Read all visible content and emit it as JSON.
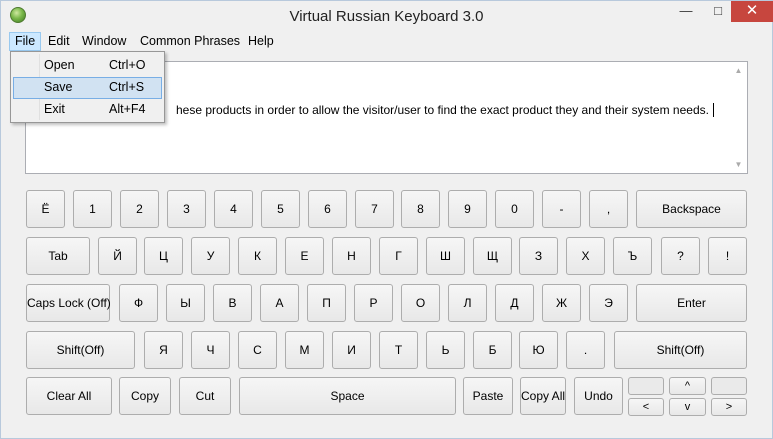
{
  "window": {
    "title": "Virtual Russian Keyboard 3.0",
    "minimize_glyph": "—",
    "maximize_glyph": "□",
    "close_glyph": "✕"
  },
  "menu": {
    "items": [
      "File",
      "Edit",
      "Window",
      "Common Phrases",
      "Help"
    ],
    "active": "File",
    "file_dropdown": [
      {
        "label": "Open",
        "shortcut": "Ctrl+O"
      },
      {
        "label": "Save",
        "shortcut": "Ctrl+S"
      },
      {
        "label": "Exit",
        "shortcut": "Alt+F4"
      }
    ],
    "hovered": "Save"
  },
  "editor": {
    "visible_text": "hese products in order to allow the visitor/user to find the exact product they and their system needs."
  },
  "scrollbar": {
    "up_glyph": "▲",
    "down_glyph": "▼"
  },
  "keyboard": {
    "row1": [
      "Ё",
      "1",
      "2",
      "3",
      "4",
      "5",
      "6",
      "7",
      "8",
      "9",
      "0",
      "-",
      ",",
      "Backspace"
    ],
    "row2": [
      "Tab",
      "Й",
      "Ц",
      "У",
      "К",
      "Е",
      "Н",
      "Г",
      "Ш",
      "Щ",
      "З",
      "Х",
      "Ъ",
      "?",
      "!"
    ],
    "row3": [
      "Caps Lock (Off)",
      "Ф",
      "Ы",
      "В",
      "А",
      "П",
      "Р",
      "О",
      "Л",
      "Д",
      "Ж",
      "Э",
      "Enter"
    ],
    "row4": [
      "Shift(Off)",
      "Я",
      "Ч",
      "С",
      "М",
      "И",
      "Т",
      "Ь",
      "Б",
      "Ю",
      ".",
      "Shift(Off)"
    ],
    "row5": [
      "Clear All",
      "Copy",
      "Cut",
      "Space",
      "Paste",
      "Copy All",
      "Undo"
    ],
    "arrows": {
      "up": "^",
      "left": "<",
      "down": "v",
      "right": ">"
    }
  }
}
